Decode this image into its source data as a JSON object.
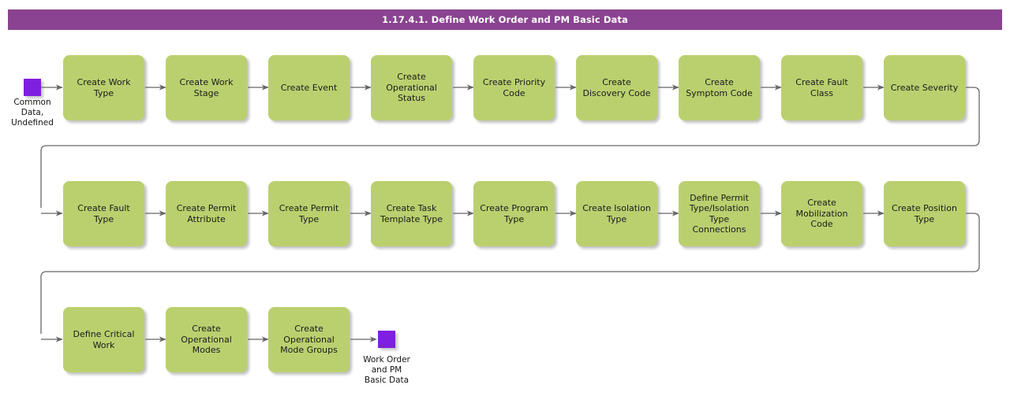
{
  "diagram": {
    "title": "1.17.4.1. Define Work Order and PM Basic Data",
    "colors": {
      "title_bar": "#8A4391",
      "title_text": "#FFFFFF",
      "node_fill": "#BAD06F",
      "terminator_fill": "#7F1FE0",
      "connector": "#666666",
      "background": "#FFFFFF"
    },
    "start_terminator": {
      "label": "Common\nData,\nUndefined",
      "shape": "square"
    },
    "end_terminator": {
      "label": "Work Order\nand PM\nBasic Data",
      "shape": "square"
    },
    "rows": [
      {
        "index": 1,
        "nodes": [
          {
            "label": "Create Work\nType"
          },
          {
            "label": "Create Work\nStage"
          },
          {
            "label": "Create Event"
          },
          {
            "label": "Create\nOperational\nStatus"
          },
          {
            "label": "Create Priority\nCode"
          },
          {
            "label": "Create\nDiscovery Code"
          },
          {
            "label": "Create\nSymptom Code"
          },
          {
            "label": "Create Fault\nClass"
          },
          {
            "label": "Create Severity"
          }
        ]
      },
      {
        "index": 2,
        "nodes": [
          {
            "label": "Create Fault\nType"
          },
          {
            "label": "Create Permit\nAttribute"
          },
          {
            "label": "Create Permit\nType"
          },
          {
            "label": "Create Task\nTemplate Type"
          },
          {
            "label": "Create Program\nType"
          },
          {
            "label": "Create Isolation\nType"
          },
          {
            "label": "Define Permit\nType/Isolation\nType\nConnections"
          },
          {
            "label": "Create\nMobilization\nCode"
          },
          {
            "label": "Create Position\nType"
          }
        ]
      },
      {
        "index": 3,
        "nodes": [
          {
            "label": "Define Critical\nWork"
          },
          {
            "label": "Create\nOperational\nModes"
          },
          {
            "label": "Create\nOperational\nMode Groups"
          }
        ]
      }
    ]
  }
}
